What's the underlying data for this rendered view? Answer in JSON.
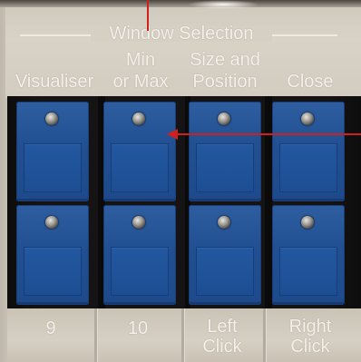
{
  "panel": {
    "section_title": "Window Selection",
    "columns": [
      {
        "top_line1": "",
        "top_line2": "Visualiser",
        "bottom_line1": "9",
        "bottom_line2": ""
      },
      {
        "top_line1": "Min",
        "top_line2": "or Max",
        "bottom_line1": "10",
        "bottom_line2": ""
      },
      {
        "top_line1": "Size and",
        "top_line2": "Position",
        "bottom_line1": "Left",
        "bottom_line2": "Click"
      },
      {
        "top_line1": "",
        "top_line2": "Close",
        "bottom_line1": "Right",
        "bottom_line2": "Click"
      }
    ]
  },
  "colors": {
    "key_blue": "#214f92",
    "annotation_red": "#d0201c",
    "label_text": "#f4f1ea"
  }
}
